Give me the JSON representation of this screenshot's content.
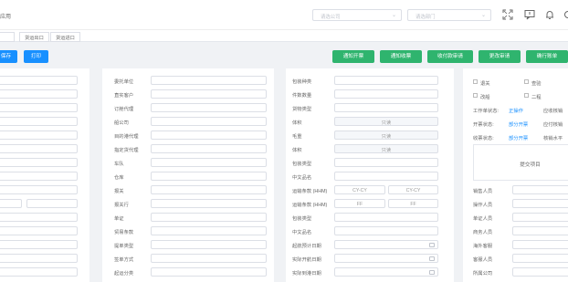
{
  "header": {
    "title": "应用",
    "company_placeholder": "请选公司",
    "dept_placeholder": "请选部门",
    "icons": [
      "fullscreen-icon",
      "message-icon",
      "bell-icon",
      "settings-icon"
    ]
  },
  "tabs": [
    "货运出口",
    "货运进口",
    "货运进口"
  ],
  "toolbar": {
    "left_buttons": [
      "保存",
      "打印"
    ],
    "right_buttons": [
      "通知开票",
      "通知收票",
      "收付款审请",
      "更改审请",
      "确行账单"
    ]
  },
  "col2": {
    "labels": [
      "委托单位",
      "直实客户",
      "订舱代理",
      "船公司",
      "目的港代理",
      "指定货代理",
      "车队",
      "仓库",
      "报关",
      "报关行",
      "单证",
      "贸易条款",
      "提单类型",
      "签单方式",
      "起运分类"
    ]
  },
  "col3": {
    "labels": [
      "包装种类",
      "件数数量",
      "货物类型",
      "体积",
      "毛重",
      "体积",
      "包装类型",
      "中文品名",
      "运输条款 (HHM)",
      "运输条款 (HHM)",
      "包装类型",
      "中文品名",
      "起航预计日期",
      "实际开航日期",
      "实际到港日期"
    ],
    "fields": [
      "",
      "",
      "",
      "只读",
      "只读",
      "只读",
      "",
      "",
      "",
      "",
      "",
      "",
      "",
      "",
      ""
    ],
    "terms": [
      [
        "CY-CY",
        "CY-CY"
      ],
      [
        "FF",
        "FF"
      ]
    ]
  },
  "col4": {
    "checks": [
      [
        "退关",
        "查验"
      ],
      [
        "改船",
        "二程"
      ]
    ],
    "status": [
      {
        "label": "工作单状态:",
        "value": "正操作",
        "extra": "应收核销"
      },
      {
        "label": "开票状态:",
        "value": "部分开票",
        "extra": "应付核销"
      },
      {
        "label": "收票状态:",
        "value": "部分开票",
        "extra": "核销水平"
      }
    ],
    "upload_label": "提交项目",
    "people": [
      "销售人员",
      "操作人员",
      "单证人员",
      "商务人员",
      "海外客服",
      "客服人员",
      "所属公司"
    ]
  }
}
